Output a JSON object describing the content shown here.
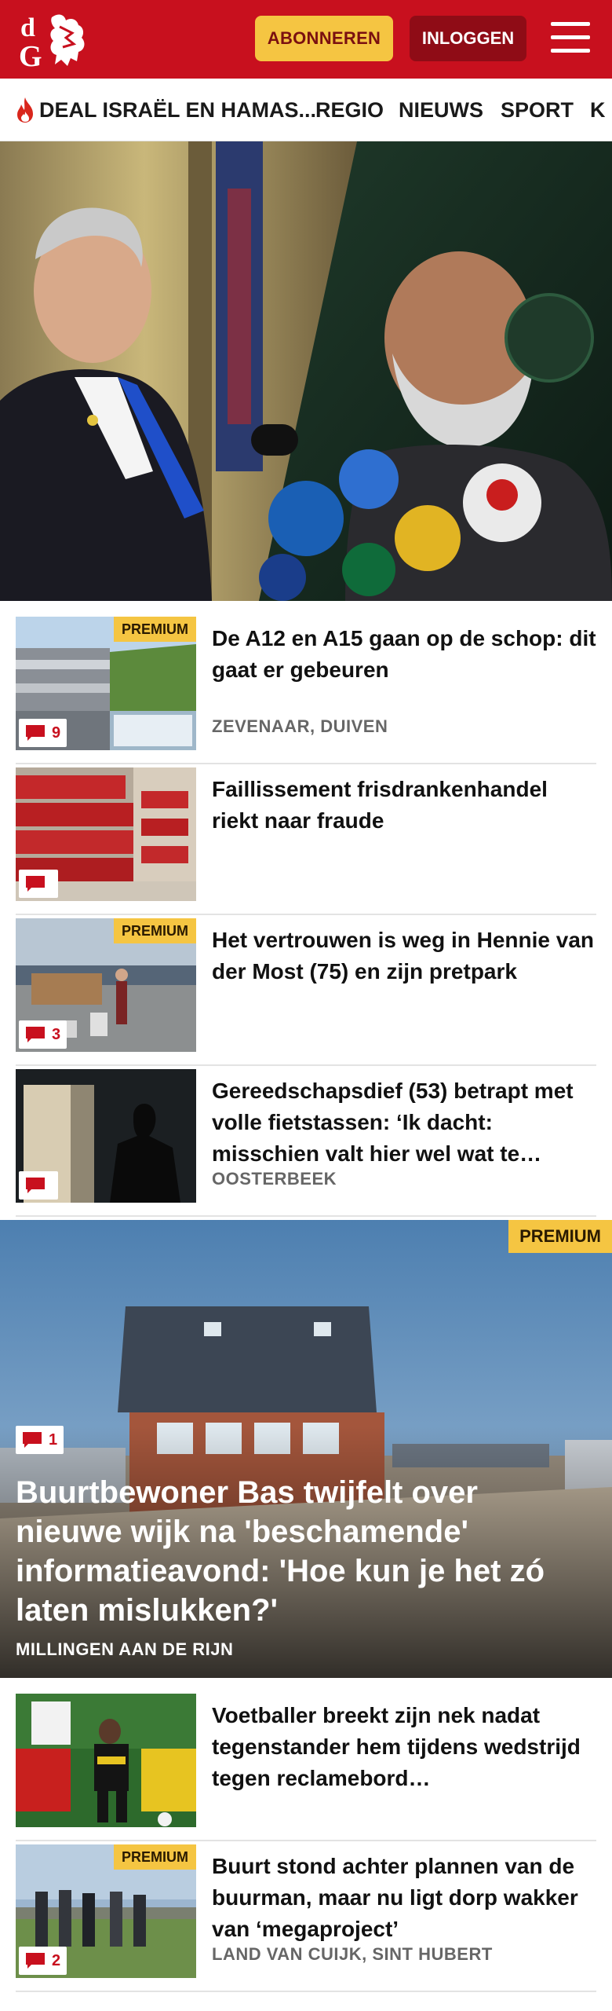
{
  "header": {
    "subscribe_label": "ABONNEREN",
    "login_label": "INLOGGEN",
    "logo_icon": "dG-griffin-logo",
    "menu_icon": "hamburger-menu-icon",
    "brand_color": "#c8101e"
  },
  "nav": {
    "items": [
      {
        "label": "DEAL ISRAËL EN HAMAS...",
        "icon": "flame-icon"
      },
      {
        "label": "REGIO"
      },
      {
        "label": "NIEUWS"
      },
      {
        "label": "SPORT"
      },
      {
        "label": "K"
      }
    ]
  },
  "articles": [
    {
      "title": "De A12 en A15 gaan op de schop: dit gaat er gebeuren",
      "location": "ZEVENAAR, DUIVEN",
      "premium": "PREMIUM",
      "comments": "9"
    },
    {
      "title": "Faillissement frisdrankenhandel riekt naar fraude",
      "location": "",
      "premium": "",
      "comments": ""
    },
    {
      "title": "Het vertrouwen is weg in Hennie van der Most (75) en zijn pretpark",
      "location": "",
      "premium": "PREMIUM",
      "comments": "3"
    },
    {
      "title": "Gereedschapsdief (53) betrapt met volle fietstassen: ‘Ik dacht: misschien valt hier wel wat te…",
      "location": "OOSTERBEEK",
      "premium": "",
      "comments": ""
    }
  ],
  "feature": {
    "premium": "PREMIUM",
    "comments": "1",
    "title": "Buurtbewoner Bas twijfelt over nieuwe wijk na 'beschamende' informatieavond: 'Hoe kun je het zó laten mislukken?'",
    "location": "MILLINGEN AAN DE RIJN"
  },
  "articles2": [
    {
      "title": "Voetballer breekt zijn nek nadat tegenstander hem tijdens wedstrijd tegen reclamebord…",
      "location": "",
      "premium": "",
      "comments": ""
    },
    {
      "title": "Buurt stond achter plannen van de buurman, maar nu ligt dorp wakker van ‘megaproject’",
      "location": "LAND VAN CUIJK, SINT HUBERT",
      "premium": "PREMIUM",
      "comments": "2"
    }
  ]
}
